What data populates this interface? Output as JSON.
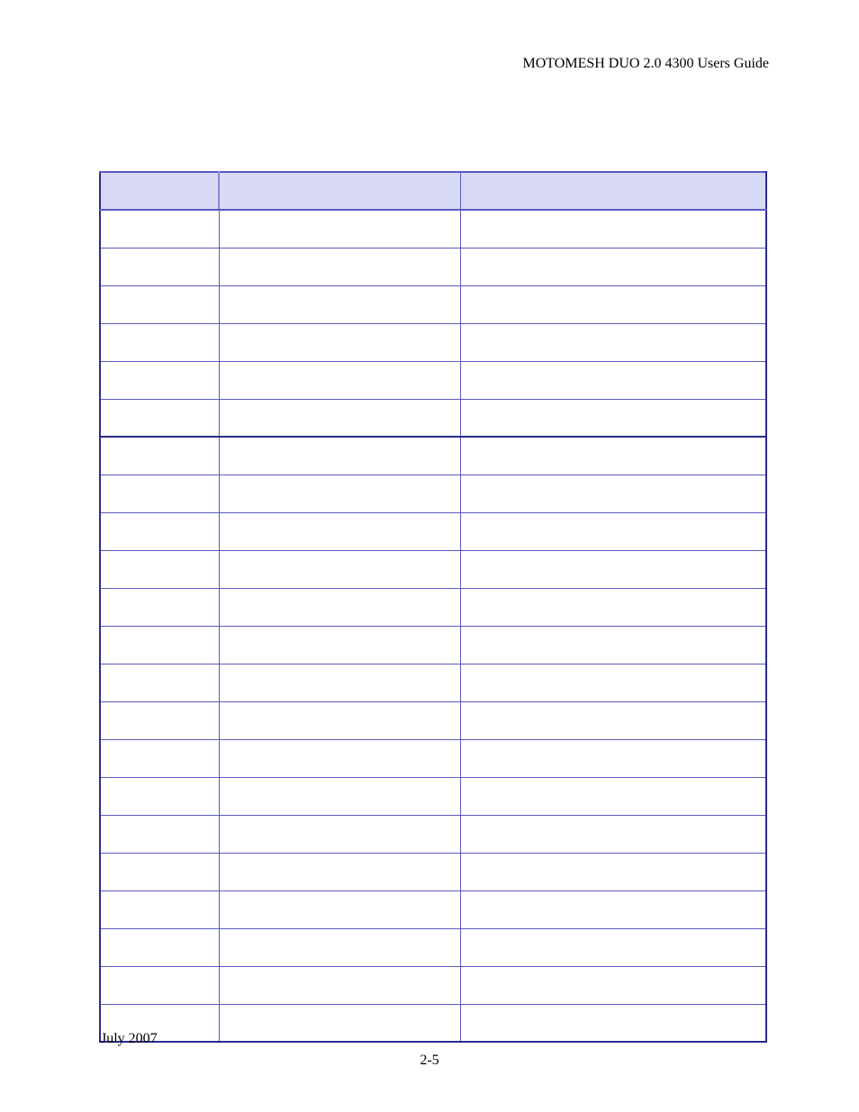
{
  "header": {
    "running_title": "MOTOMESH DUO 2.0 4300 Users Guide"
  },
  "table": {
    "columns": [
      "",
      "",
      ""
    ],
    "rows": [
      [
        "",
        "",
        ""
      ],
      [
        "",
        "",
        ""
      ],
      [
        "",
        "",
        ""
      ],
      [
        "",
        "",
        ""
      ],
      [
        "",
        "",
        ""
      ],
      [
        "",
        "",
        ""
      ],
      [
        "",
        "",
        ""
      ],
      [
        "",
        "",
        ""
      ],
      [
        "",
        "",
        ""
      ],
      [
        "",
        "",
        ""
      ],
      [
        "",
        "",
        ""
      ],
      [
        "",
        "",
        ""
      ],
      [
        "",
        "",
        ""
      ],
      [
        "",
        "",
        ""
      ],
      [
        "",
        "",
        ""
      ],
      [
        "",
        "",
        ""
      ],
      [
        "",
        "",
        ""
      ],
      [
        "",
        "",
        ""
      ],
      [
        "",
        "",
        ""
      ],
      [
        "",
        "",
        ""
      ],
      [
        "",
        "",
        ""
      ],
      [
        "",
        "",
        ""
      ]
    ]
  },
  "footer": {
    "date": "July 2007",
    "page_number": "2-5"
  }
}
